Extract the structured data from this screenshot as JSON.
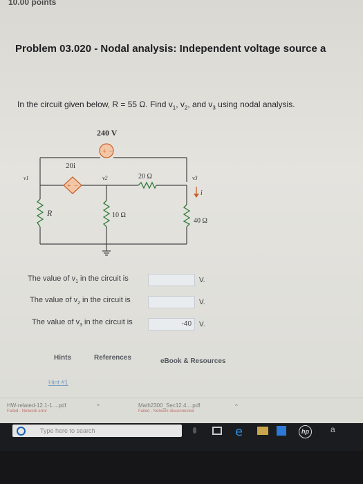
{
  "header": {
    "points": "10.00 points"
  },
  "problem": {
    "title": "Problem 03.020 - Nodal analysis: Independent voltage source a",
    "text_before": "In the circuit given below, R = 55 Ω. Find v",
    "text_comma1": ", v",
    "text_and": ", and v",
    "text_after": " using nodal analysis.",
    "sub1": "1",
    "sub2": "2",
    "sub3": "3"
  },
  "circuit": {
    "source_voltage": "240 V",
    "dependent_source": "20i",
    "resistor_r": "R",
    "resistor_10": "10 Ω",
    "resistor_20": "20 Ω",
    "resistor_40": "40 Ω",
    "node1": "v1",
    "node2": "v2",
    "node3": "v3",
    "current": "i"
  },
  "answers": [
    {
      "label_a": "The value of v",
      "sub": "1",
      "label_b": " in the circuit is",
      "value": "",
      "unit": "V."
    },
    {
      "label_a": "The value of v",
      "sub": "2",
      "label_b": " in the circuit is",
      "value": "",
      "unit": "V."
    },
    {
      "label_a": "The value of v",
      "sub": "3",
      "label_b": " in the circuit is",
      "value": "-40",
      "unit": "V."
    }
  ],
  "links": {
    "hints": "Hints",
    "references": "References",
    "ebook": "eBook & Resources",
    "hint1": "Hint #1"
  },
  "downloads": [
    {
      "name": "HW-related-12.1-1....pdf",
      "status": "Failed - Network error"
    },
    {
      "name": "Math2300_Sec12.4....pdf",
      "status": "Failed - Network disconnected"
    }
  ],
  "taskbar": {
    "search_placeholder": "Type here to search",
    "extra": "a"
  }
}
